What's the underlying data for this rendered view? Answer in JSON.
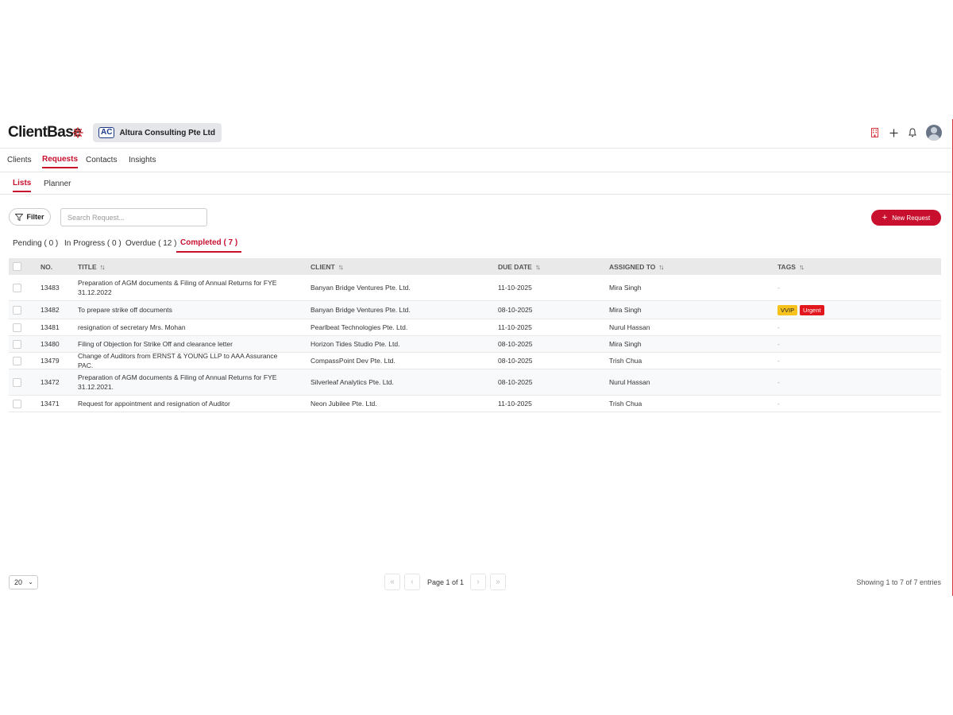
{
  "header": {
    "logo": "ClientBase",
    "org_badge": "AC",
    "org_name": "Altura Consulting Pte Ltd"
  },
  "icons": {
    "building": "building-icon",
    "add": "plus-icon",
    "notifications": "bell-icon",
    "profile": "avatar"
  },
  "nav": {
    "tabs": [
      {
        "label": "Clients"
      },
      {
        "label": "Requests",
        "active": true
      },
      {
        "label": "Contacts"
      },
      {
        "label": "Insights"
      }
    ]
  },
  "subnav": {
    "tabs": [
      {
        "label": "Lists",
        "active": true
      },
      {
        "label": "Planner"
      }
    ]
  },
  "toolbar": {
    "filter_label": "Filter",
    "search_placeholder": "Search Request...",
    "new_request_label": "New Request"
  },
  "status_tabs": [
    {
      "label": "Pending ( 0 )"
    },
    {
      "label": "In Progress ( 0 )"
    },
    {
      "label": "Overdue ( 12 )"
    },
    {
      "label": "Completed ( 7 )",
      "active": true
    }
  ],
  "table": {
    "columns": [
      "NO.",
      "TITLE",
      "CLIENT",
      "DUE DATE",
      "ASSIGNED TO",
      "TAGS"
    ],
    "rows": [
      {
        "no": "13483",
        "title": "Preparation of AGM documents & Filing of Annual Returns for FYE 31.12.2022",
        "client": "Banyan Bridge Ventures Pte. Ltd.",
        "due": "11-10-2025",
        "assigned": "Mira Singh",
        "tags": []
      },
      {
        "no": "13482",
        "title": "To prepare strike off documents",
        "client": "Banyan Bridge Ventures Pte. Ltd.",
        "due": "08-10-2025",
        "assigned": "Mira Singh",
        "tags": [
          "VVIP",
          "Urgent"
        ]
      },
      {
        "no": "13481",
        "title": "resignation of secretary Mrs. Mohan",
        "client": "Pearlbeat Technologies Pte. Ltd.",
        "due": "11-10-2025",
        "assigned": "Nurul Hassan",
        "tags": []
      },
      {
        "no": "13480",
        "title": "Filing of Objection for Strike Off and clearance letter",
        "client": "Horizon Tides Studio Pte. Ltd.",
        "due": "08-10-2025",
        "assigned": "Mira Singh",
        "tags": []
      },
      {
        "no": "13479",
        "title": "Change of Auditors from ERNST & YOUNG LLP to AAA Assurance PAC.",
        "client": "CompassPoint Dev Pte. Ltd.",
        "due": "08-10-2025",
        "assigned": "Trish Chua",
        "tags": []
      },
      {
        "no": "13472",
        "title": "Preparation of AGM documents & Filing of Annual Returns for FYE 31.12.2021.",
        "client": "Silverleaf Analytics Pte. Ltd.",
        "due": "08-10-2025",
        "assigned": "Nurul Hassan",
        "tags": []
      },
      {
        "no": "13471",
        "title": "Request for appointment and resignation of Auditor",
        "client": "Neon Jubilee Pte. Ltd.",
        "due": "11-10-2025",
        "assigned": "Trish Chua",
        "tags": []
      }
    ],
    "empty_tag": "-"
  },
  "footer": {
    "page_size": "20",
    "page_label": "Page 1 of 1",
    "showing": "Showing 1 to 7 of 7 entries"
  },
  "colors": {
    "accent": "#c8102e",
    "vvip": "#f7c21e",
    "urgent": "#e2161d"
  }
}
